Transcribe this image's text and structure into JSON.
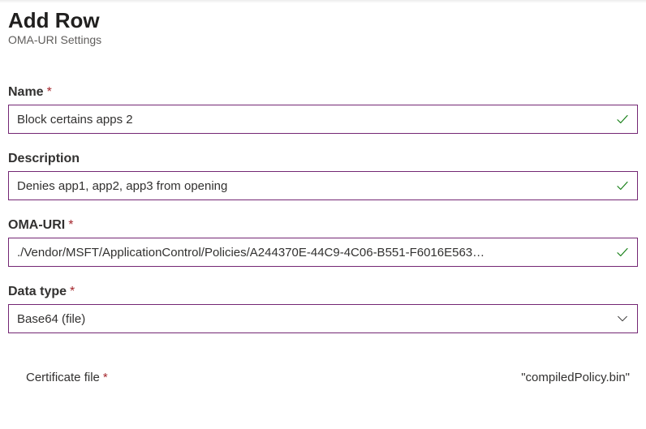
{
  "header": {
    "title": "Add Row",
    "subtitle": "OMA-URI Settings"
  },
  "required_marker": "*",
  "fields": {
    "name": {
      "label": "Name",
      "value": "Block certains apps 2",
      "required": true,
      "validated": true
    },
    "description": {
      "label": "Description",
      "value": "Denies app1, app2, app3 from opening",
      "required": false,
      "validated": true
    },
    "oma_uri": {
      "label": "OMA-URI",
      "value": "./Vendor/MSFT/ApplicationControl/Policies/A244370E-44C9-4C06-B551-F6016E563…",
      "required": true,
      "validated": true
    },
    "data_type": {
      "label": "Data type",
      "value": "Base64 (file)",
      "required": true
    }
  },
  "certificate": {
    "label": "Certificate file",
    "required": true,
    "value": "\"compiledPolicy.bin\""
  }
}
